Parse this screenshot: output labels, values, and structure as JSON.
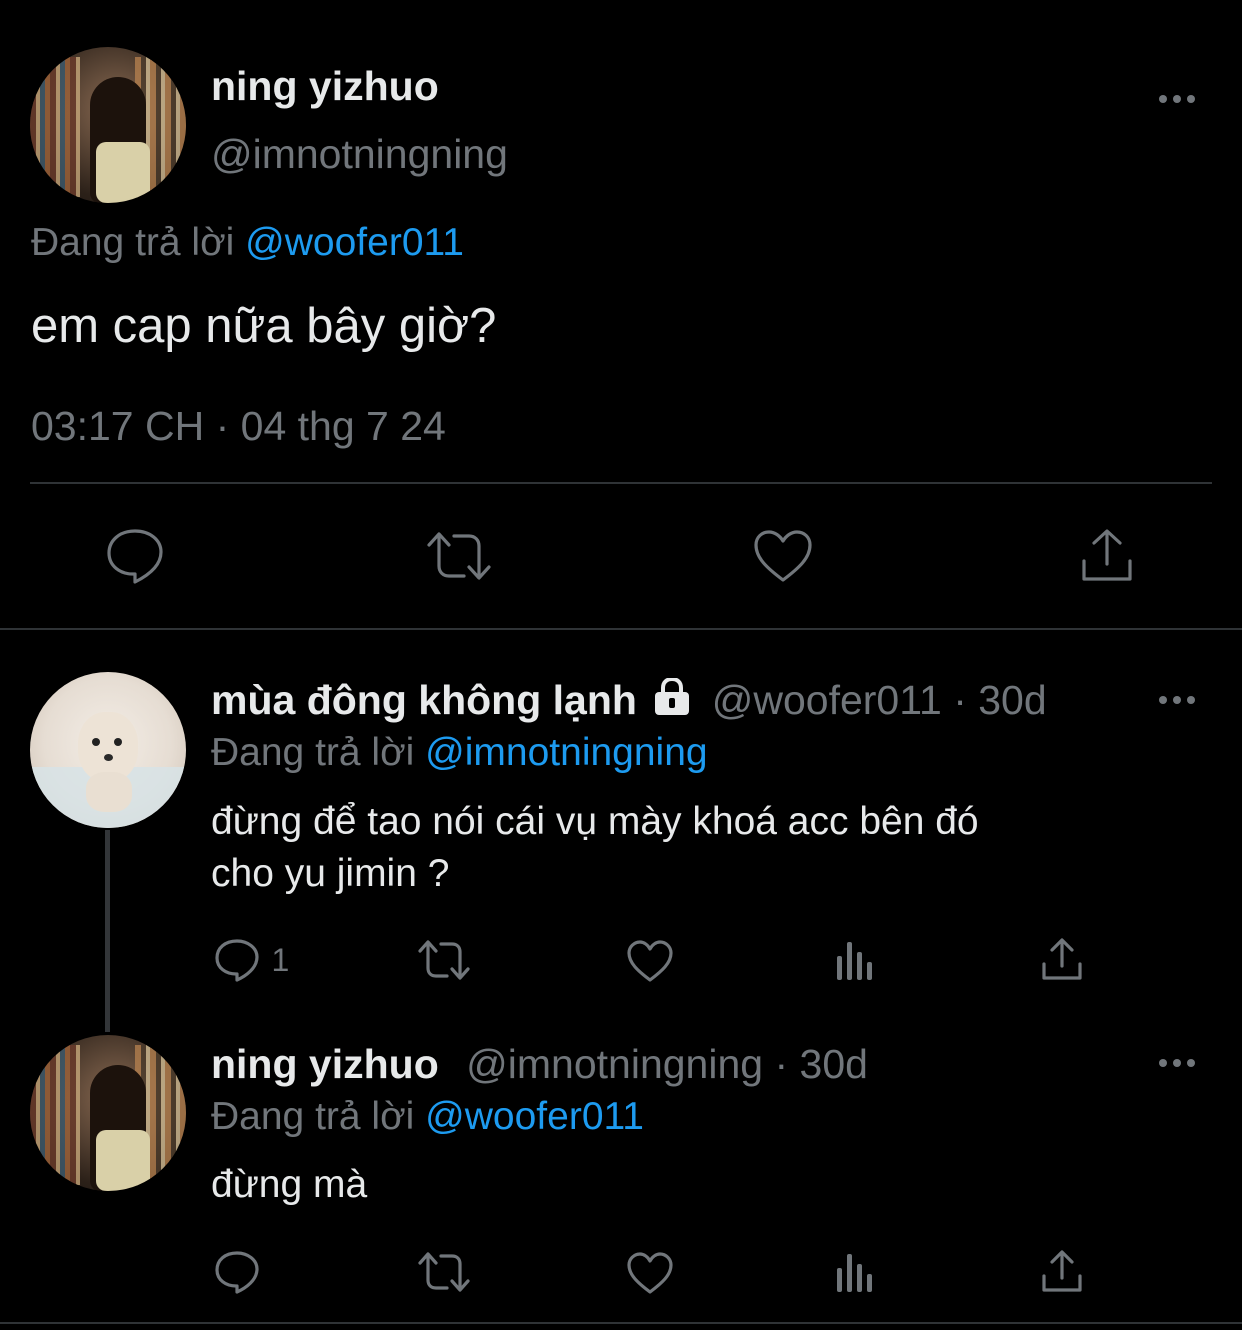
{
  "main_tweet": {
    "author_name": "ning yizhuo",
    "author_handle": "@imnotningning",
    "reply_prefix": "Đang trả lời",
    "reply_to": "@woofer011",
    "text": "em cap nữa bây giờ?",
    "timestamp": "03:17 CH · 04 thg 7 24",
    "actions": [
      "reply-icon",
      "retweet-icon",
      "like-icon",
      "share-icon"
    ]
  },
  "replies": [
    {
      "author_name": "mùa đông không lạnh",
      "locked": true,
      "author_handle": "@woofer011",
      "separator": "·",
      "age": "30d",
      "reply_prefix": "Đang trả lời",
      "reply_to": "@imnotningning",
      "text_line1": "đừng để tao nói cái vụ mày khoá acc bên đó",
      "text_line2": "cho yu jimin ?",
      "reply_count": "1"
    },
    {
      "author_name": "ning yizhuo",
      "author_handle": "@imnotningning",
      "separator": "·",
      "age": "30d",
      "reply_prefix": "Đang trả lời",
      "reply_to": "@woofer011",
      "text": "đừng mà",
      "reply_count": ""
    }
  ],
  "colors": {
    "background": "#000000",
    "text": "#e7e9ea",
    "muted": "#71767b",
    "link": "#1d9bf0",
    "divider": "#2f3336"
  }
}
